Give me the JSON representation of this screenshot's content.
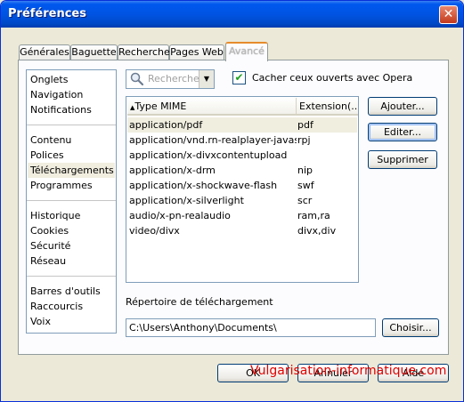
{
  "window": {
    "title": "Préférences",
    "close_glyph": "✕"
  },
  "tabs": [
    {
      "label": "Générales"
    },
    {
      "label": "Baguette"
    },
    {
      "label": "Recherche"
    },
    {
      "label": "Pages Web"
    },
    {
      "label": "Avancé",
      "active": true
    }
  ],
  "sidebar": {
    "groups": [
      [
        "Onglets",
        "Navigation",
        "Notifications"
      ],
      [
        "Contenu",
        "Polices",
        "Téléchargements",
        "Programmes"
      ],
      [
        "Historique",
        "Cookies",
        "Sécurité",
        "Réseau"
      ],
      [
        "Barres d'outils",
        "Raccourcis",
        "Voix"
      ]
    ],
    "selected": "Téléchargements"
  },
  "search": {
    "placeholder": "Recherche r",
    "icon": "magnifier-icon",
    "dropdown_glyph": "▼"
  },
  "hide_opened": {
    "label": "Cacher ceux ouverts avec Opera",
    "checked": true,
    "glyph": "✔"
  },
  "table": {
    "columns": [
      "Type MIME",
      "Extension(..."
    ],
    "sort_glyph": "▲",
    "rows": [
      {
        "mime": "application/pdf",
        "ext": "pdf",
        "selected": true
      },
      {
        "mime": "application/vnd.rn-realplayer-javascr...",
        "ext": "rpj"
      },
      {
        "mime": "application/x-divxcontentupload",
        "ext": ""
      },
      {
        "mime": "application/x-drm",
        "ext": "nip"
      },
      {
        "mime": "application/x-shockwave-flash",
        "ext": "swf"
      },
      {
        "mime": "application/x-silverlight",
        "ext": "scr"
      },
      {
        "mime": "audio/x-pn-realaudio",
        "ext": "ram,ra"
      },
      {
        "mime": "video/divx",
        "ext": "divx,div"
      }
    ]
  },
  "buttons": {
    "add": "Ajouter...",
    "edit": "Editer...",
    "delete": "Supprimer",
    "choose": "Choisir...",
    "ok": "OK",
    "cancel": "Annuler",
    "help": "Aide"
  },
  "download": {
    "label": "Répertoire de téléchargement",
    "path": "C:\\Users\\Anthony\\Documents\\"
  },
  "watermark": "Vulgarisation-informatique.com"
}
